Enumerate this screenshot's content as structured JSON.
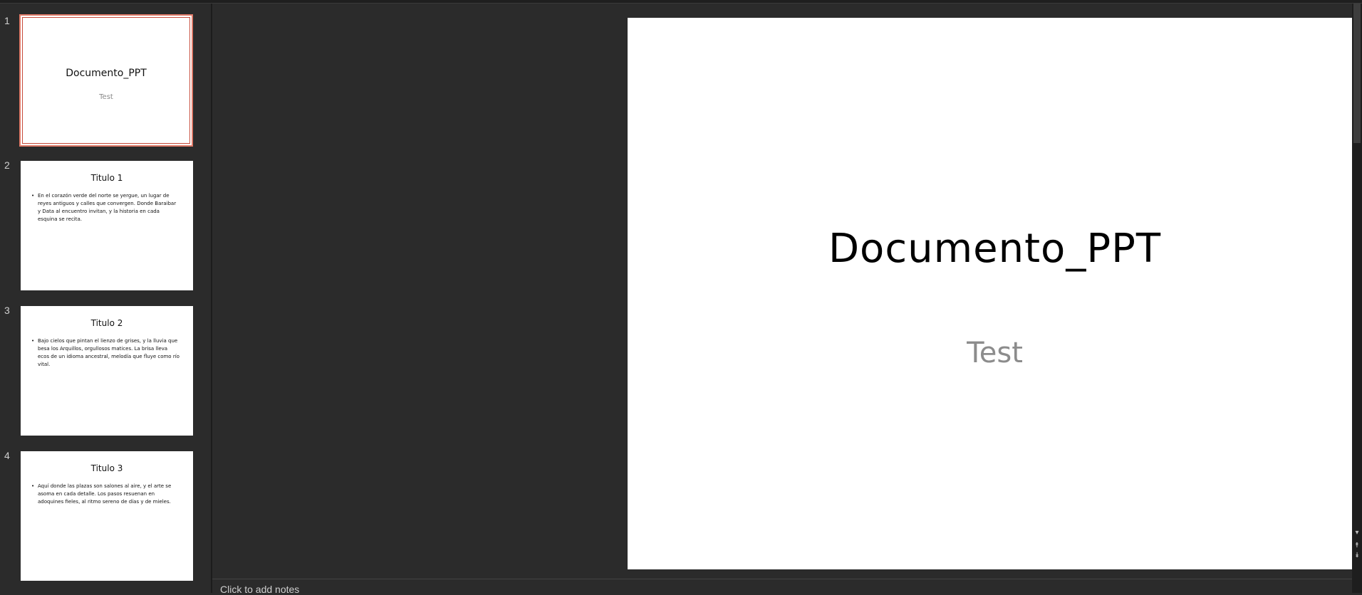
{
  "thumbnails": [
    {
      "number": "1",
      "title": "Documento_PPT",
      "subtitle": "Test"
    },
    {
      "number": "2",
      "title": "Titulo 1",
      "body": "En el corazón verde del norte se yergue, un lugar de reyes antiguos y calles que convergen. Donde Baraibar y Data al encuentro invitan, y la historia en cada esquina se recita."
    },
    {
      "number": "3",
      "title": "Titulo 2",
      "body": "Bajo cielos que pintan el lienzo de grises, y la lluvia que besa los Arquillos, orgullosos matices. La brisa lleva ecos de un idioma ancestral, melodía que fluye como río vital."
    },
    {
      "number": "4",
      "title": "Titulo 3",
      "body": "Aquí donde las plazas son salones al aire, y el arte se asoma en cada detalle. Los pasos resuenan en adoquines fieles, al ritmo sereno de días y de mieles."
    }
  ],
  "main_slide": {
    "title": "Documento_PPT",
    "subtitle": "Test"
  },
  "notes": {
    "placeholder": "Click to add notes"
  },
  "scrollbar": {
    "up_icon": "▾",
    "prev_icon": "⯭",
    "next_icon": "⯯"
  },
  "colors": {
    "selection_border": "#e07b69",
    "background": "#2b2b2b"
  }
}
